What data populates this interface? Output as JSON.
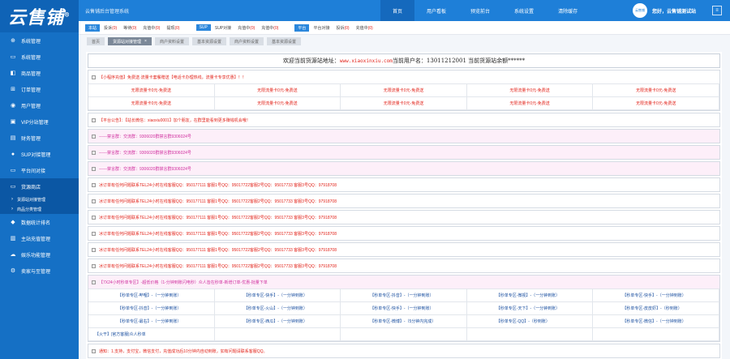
{
  "logo": "云售铺",
  "logo_mark": "®",
  "sidebar": {
    "items": [
      {
        "icon": "globe-icon",
        "glyph": "⊕",
        "label": "系统管理"
      },
      {
        "icon": "monitor-icon",
        "glyph": "▭",
        "label": "系统管理"
      },
      {
        "icon": "bag-icon",
        "glyph": "◧",
        "label": "商品管理"
      },
      {
        "icon": "cart-icon",
        "glyph": "⊞",
        "label": "订单管理"
      },
      {
        "icon": "map-pin-icon",
        "glyph": "◉",
        "label": "用户管理"
      },
      {
        "icon": "gift-icon",
        "glyph": "▣",
        "label": "VIP分站管理"
      },
      {
        "icon": "wallet-icon",
        "glyph": "▤",
        "label": "财务管理"
      },
      {
        "icon": "user-icon",
        "glyph": "●",
        "label": "SUP对接管理"
      },
      {
        "icon": "platform-icon",
        "glyph": "▭",
        "label": "平台间对接"
      },
      {
        "icon": "shop-icon",
        "glyph": "▭",
        "label": "货源商店",
        "active": true
      },
      {
        "sub": true,
        "label": "货源站对接管理"
      },
      {
        "sub": true,
        "label": "商品分类管理"
      },
      {
        "icon": "rocket-icon",
        "glyph": "◆",
        "label": "数据统计排名"
      },
      {
        "icon": "server-icon",
        "glyph": "▥",
        "label": "主站充值管理"
      },
      {
        "icon": "cloud-icon",
        "glyph": "☁",
        "label": "娱乐功能管理"
      },
      {
        "icon": "settings-icon",
        "glyph": "⚙",
        "label": "卖家与至管理"
      }
    ]
  },
  "header": {
    "title": "云售铺后台管理系统",
    "nav": [
      "首页",
      "用户看板",
      "预览前台",
      "系统设置",
      "清除缓存"
    ],
    "avatar_text": "云售铺",
    "greeting": "您好，云售铺测试站",
    "menu_glyph": "≡"
  },
  "statusbar": {
    "groups": [
      {
        "tag": "本站",
        "items": [
          {
            "text": "投诉",
            "count": "(0)"
          },
          {
            "text": "等待",
            "count": "(0)"
          },
          {
            "text": "充值中",
            "count": "(0)"
          },
          {
            "text": "提现",
            "count": "(0)"
          }
        ]
      },
      {
        "tag": "SUP",
        "items": [
          {
            "text": "SUP对接",
            "count": ""
          },
          {
            "text": "充值中",
            "count": "(0)"
          },
          {
            "text": "充值中",
            "count": "(0)"
          }
        ]
      },
      {
        "tag": "平台",
        "items": [
          {
            "text": "平台对接",
            "count": ""
          },
          {
            "text": "投诉",
            "count": "(0)"
          },
          {
            "text": "充值中",
            "count": "(0)"
          }
        ]
      }
    ]
  },
  "tabs": [
    {
      "label": "首页",
      "active": false,
      "close": ""
    },
    {
      "label": "货源站对接管理",
      "active": true,
      "close": "×"
    },
    {
      "label": "商户资料设置",
      "active": false,
      "close": ""
    },
    {
      "label": "基本资源设置",
      "active": false,
      "close": ""
    },
    {
      "label": "商户资料设置",
      "active": false,
      "close": ""
    },
    {
      "label": "基本资源设置",
      "active": false,
      "close": ""
    }
  ],
  "welcome": {
    "prefix": "欢迎当前货源站地址：",
    "domain": "www.xiaoxinxiu.com",
    "suffix": "当前用户名：13011212001 当前货源站余额******"
  },
  "panels": [
    {
      "style": "red",
      "title": "【小程序充值】免费送·流量卡套餐赠送【电话卡办理热线，流量卡专享优惠】！！",
      "cols": 5,
      "rows": [
        [
          "无限流量卡0元-免费送",
          "无限流量卡0元-免费送",
          "无限流量卡0元-免费送",
          "无限流量卡0元-免费送",
          "无限流量卡0元-免费送"
        ],
        [
          "无限流量卡0元-免费送",
          "无限流量卡0元-免费送",
          "无限流量卡0元-免费送",
          "无限流量卡0元-免费送",
          "无限流量卡0元-免费送"
        ]
      ]
    },
    {
      "style": "red",
      "title": "【平台公告】：【站长微信：xiaoxiu0001】加个朋友，在群里能看到更多赚钱机会哦！",
      "cols": 0,
      "rows": []
    },
    {
      "style": "pink",
      "title": "------禁言群：交流群：9306020群禁言群9306024号",
      "cols": 0,
      "rows": []
    },
    {
      "style": "pink",
      "title": "------禁言群：交流群：9306020群禁言群9306024号",
      "cols": 0,
      "rows": []
    },
    {
      "style": "pink",
      "title": "------禁言群：交流群：9306020群禁言群9306024号",
      "cols": 0,
      "rows": []
    },
    {
      "style": "red",
      "title": "冰订单有任何问题联系TEL24小时在线客服QQ：950177111 客服1号QQ：95017722客服2号QQ：95017733 客服3号QQ：97918708",
      "cols": 0,
      "rows": []
    },
    {
      "style": "red",
      "title": "冰订单有任何问题联系TEL24小时在线客服QQ：950177111 客服1号QQ：95017722客服2号QQ：95017733 客服3号QQ：97918708",
      "cols": 0,
      "rows": []
    },
    {
      "style": "red",
      "title": "冰订单有任何问题联系TEL24小时在线客服QQ：950177111 客服1号QQ：95017722客服2号QQ：95017733 客服3号QQ：97918708",
      "cols": 0,
      "rows": []
    },
    {
      "style": "red",
      "title": "冰订单有任何问题联系TEL24小时在线客服QQ：950177111 客服1号QQ：95017722客服2号QQ：95017733 客服3号QQ：97918708",
      "cols": 0,
      "rows": []
    },
    {
      "style": "red",
      "title": "冰订单有任何问题联系TEL24小时在线客服QQ：950177111 客服1号QQ：95017722客服2号QQ：95017733 客服3号QQ：97918708",
      "cols": 0,
      "rows": []
    },
    {
      "style": "red",
      "title": "冰订单有任何问题联系TEL24小时在线客服QQ：950177111 客服1号QQ：95017722客服2号QQ：95017733 客服3号QQ：97918708",
      "cols": 0,
      "rows": []
    },
    {
      "style": "pink",
      "title": "【7X24小时秒单专区】-超低价格（1-分钟到账闪电秒）众人皆在秒单-新增订单-优惠-批量下单",
      "cols": 5,
      "rows": [
        [
          "【秒单专区-哔哩】-（一分钟到账）",
          "【秒单专区-快手】-（一分钟到账）",
          "【秒单专区-抖音】-（一分钟到账）",
          "【秒单专区-微视】-（一分钟到账）",
          "【秒单专区-快手】-（一分钟到账）"
        ],
        [
          "【秒单专区-抖音】-（一分钟到账）",
          "【秒单专区-火山】-（一分钟到账）",
          "【秒单专区-快手】-（一分钟到账）",
          "【秒单专区-天下】-（一分钟到账）",
          "【秒单专区-皮皮虾】-（秒到账）"
        ],
        [
          "【秒单专区-最右】-（一分钟到账）",
          "【秒单专区-西瓜】-（一分钟到账）",
          "【秒单专区-微博】-（5分钟内完成）",
          "【秒单专区-QQ】-（秒到账）",
          "【秒单专区-微信】-（一分钟到账）"
        ],
        [
          "【火干】|官方客服|众人秒单",
          "",
          "",
          "",
          ""
        ]
      ]
    },
    {
      "style": "red",
      "title": "通知：1.支持，支付宝，微信支付，充值成功后10分钟内自动到账，如有问题请联系客服QQ。",
      "cols": 0,
      "rows": []
    }
  ]
}
